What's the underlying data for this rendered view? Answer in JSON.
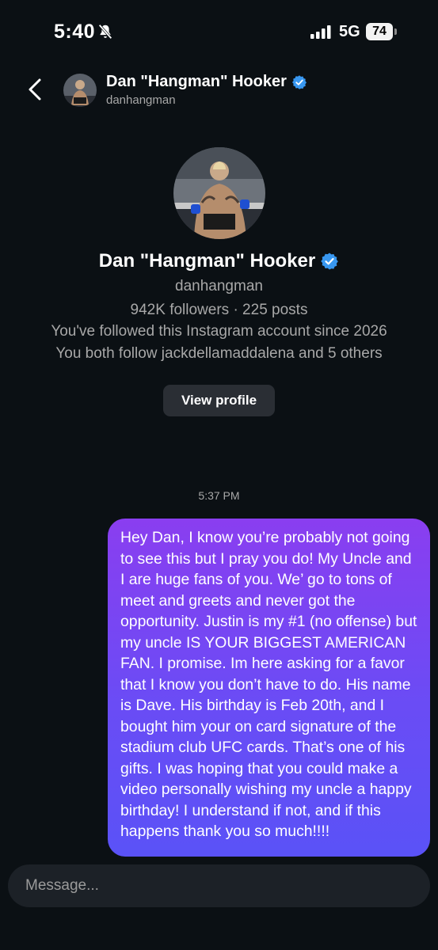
{
  "status_bar": {
    "time": "5:40",
    "network": "5G",
    "battery": "74"
  },
  "header": {
    "name": "Dan \"Hangman\" Hooker",
    "handle": "danhangman"
  },
  "profile": {
    "name": "Dan \"Hangman\" Hooker",
    "handle": "danhangman",
    "stats": "942K followers · 225 posts",
    "followed_since": "You've followed this Instagram account since 2026",
    "mutuals": "You both follow jackdellamaddalena and 5 others",
    "view_profile_label": "View profile"
  },
  "thread": {
    "timestamp": "5:37 PM",
    "message": "Hey Dan, I know you’re probably not going to see this but I pray you do! My Uncle and I are huge fans of you. We’ go to tons of meet and greets and never got the opportunity. Justin is my #1 (no offense) but my uncle IS YOUR BIGGEST AMERICAN FAN. I promise. Im here asking for a favor that I know you don’t have to do. His name is Dave. His birthday is Feb 20th, and I bought him your on card signature of the stadium club UFC cards. That’s one of his gifts. I was hoping that you could make a video personally wishing my uncle a happy birthday! I understand if not, and if this happens thank you so much!!!!"
  },
  "composer": {
    "placeholder": "Message..."
  },
  "colors": {
    "background": "#0b1014",
    "bubble_top": "#8a3ef0",
    "bubble_bottom": "#5a52f7",
    "verified": "#3897f0",
    "muted_text": "#a8a8a8"
  },
  "icons": [
    "bell-slash-icon",
    "signal-icon",
    "battery-icon",
    "back-chevron-icon",
    "verified-badge-icon"
  ]
}
